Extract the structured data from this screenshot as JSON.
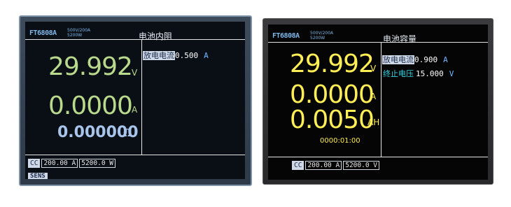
{
  "left": {
    "brand": "FT6808A",
    "spec_line1": "500V/200A",
    "spec_line2": "5200W",
    "title": "电池内阻",
    "voltage": "29.992",
    "voltage_unit": "V",
    "current": "0.0000",
    "current_unit": "A",
    "resistance": "0.000000",
    "resistance_unit": "Ω",
    "param_label": "放电电流",
    "param_value": "0.500",
    "param_unit": "A",
    "mode": "CC",
    "status_current": "200.00  A",
    "status_power": "5200.0  W",
    "sens": "SENS"
  },
  "right": {
    "brand": "FT6808A",
    "spec_line1": "500V/200A",
    "spec_line2": "5200W",
    "title": "电池容量",
    "voltage": "29.992",
    "voltage_unit": "V",
    "current": "0.0000",
    "current_unit": "A",
    "capacity": "0.0050",
    "capacity_unit": "AH",
    "timer": "0000:01:00",
    "param1_label": "放电电流",
    "param1_value": "0.900",
    "param1_unit": "A",
    "param2_label": "终止电压",
    "param2_value": "15.000",
    "param2_unit": "V",
    "mode": "CC",
    "status_current": "200.00  A",
    "status_power": "5200.0  V"
  },
  "colors": {
    "left_readout": "#b9d98c",
    "left_resistance": "#a8c4ea",
    "right_readout": "#ffee55",
    "accent_blue": "#6fb8ff",
    "highlight_cyan": "#33d6e6"
  }
}
